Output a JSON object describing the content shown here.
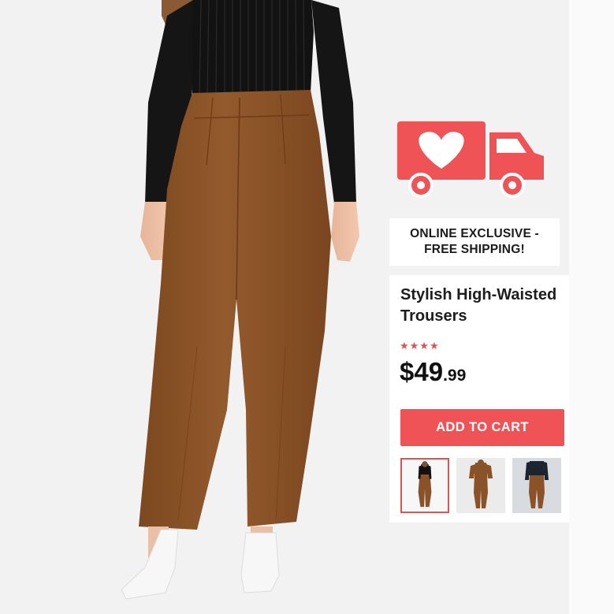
{
  "shipping": {
    "banner_line1": "ONLINE EXCLUSIVE -",
    "banner_line2": "FREE SHIPPING!",
    "icon": "heart-truck-icon",
    "icon_color": "#f05356"
  },
  "product": {
    "title": "Stylish High-Waisted Trousers",
    "rating_stars": "★★★★",
    "rating_value": 4,
    "price_main": "$49",
    "price_cents": ".99",
    "add_to_cart_label": "ADD TO CART",
    "accent_color": "#f05356",
    "pants_color": "#8a5228",
    "top_color": "#111111"
  },
  "gallery": {
    "thumbnails": [
      {
        "view": "front",
        "selected": true
      },
      {
        "view": "back",
        "selected": false
      },
      {
        "view": "back-alt",
        "selected": false
      }
    ]
  }
}
